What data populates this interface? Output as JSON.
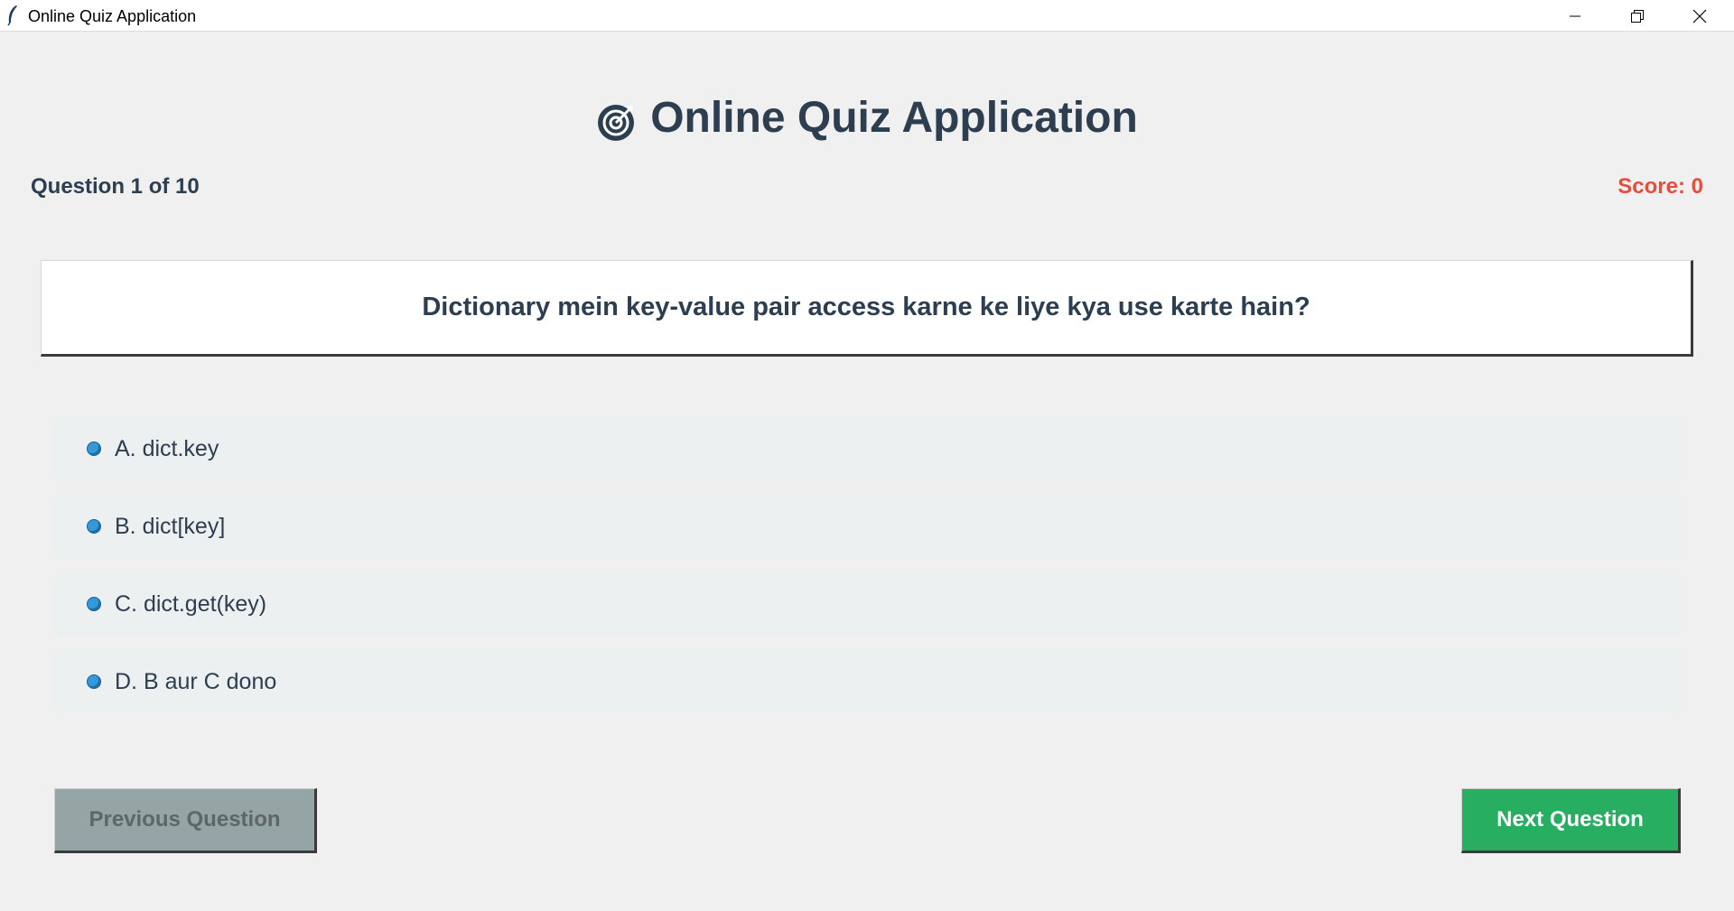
{
  "window": {
    "title": "Online Quiz Application"
  },
  "header": {
    "title": "Online Quiz Application",
    "icon": "target-icon"
  },
  "status": {
    "question_counter": "Question 1 of 10",
    "score": "Score: 0"
  },
  "question": {
    "text": "Dictionary mein key-value pair access karne ke liye kya use karte hain?"
  },
  "options": [
    {
      "label": "A. dict.key"
    },
    {
      "label": "B. dict[key]"
    },
    {
      "label": "C. dict.get(key)"
    },
    {
      "label": "D. B aur C dono"
    }
  ],
  "buttons": {
    "previous": "Previous Question",
    "next": "Next Question"
  },
  "colors": {
    "title_text": "#2c3e50",
    "score_text": "#e74c3c",
    "radio": "#3498db",
    "option_bg": "#ecf0f1",
    "prev_button": "#95a5a6",
    "next_button": "#27ae60",
    "window_bg": "#f0f0f0"
  }
}
